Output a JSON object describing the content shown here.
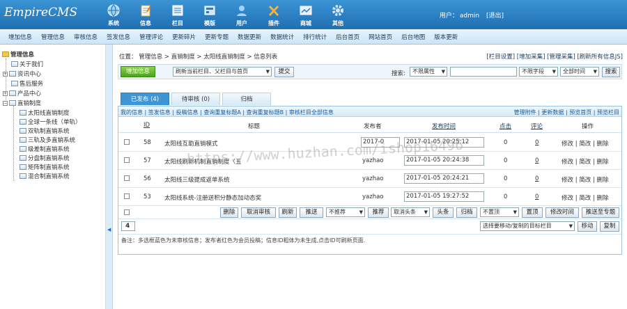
{
  "app": {
    "logo": "EmpireCMS"
  },
  "topnav": [
    {
      "label": "系统",
      "icon": "globe-icon"
    },
    {
      "label": "信息",
      "icon": "notepad-icon"
    },
    {
      "label": "栏目",
      "icon": "folder-icon"
    },
    {
      "label": "模版",
      "icon": "template-icon"
    },
    {
      "label": "用户",
      "icon": "user-icon"
    },
    {
      "label": "插件",
      "icon": "tools-icon"
    },
    {
      "label": "商城",
      "icon": "shop-icon"
    },
    {
      "label": "其他",
      "icon": "gear-icon"
    }
  ],
  "user": {
    "prefix": "用户：",
    "name": "admin",
    "logout": "[退出]"
  },
  "menubar": [
    "增加信息",
    "管理信息",
    "审核信息",
    "签发信息",
    "管理评论",
    "更新碎片",
    "更新专题",
    "数据更新",
    "数据统计",
    "排行统计",
    "后台首页",
    "网站首页",
    "后台地图",
    "版本更新"
  ],
  "sidebar": {
    "root": "管理信息",
    "items": [
      {
        "label": "关于我们",
        "type": "leaf"
      },
      {
        "label": "资讯中心",
        "type": "folder"
      },
      {
        "label": "售后服务",
        "type": "leaf"
      },
      {
        "label": "产品中心",
        "type": "folder"
      },
      {
        "label": "直销制度",
        "type": "folder-open"
      },
      {
        "label": "太阳线直销制度",
        "type": "child"
      },
      {
        "label": "全球一条线（单轨）",
        "type": "child"
      },
      {
        "label": "双轨制直销系统",
        "type": "child"
      },
      {
        "label": "三轨及多直销系统",
        "type": "child"
      },
      {
        "label": "级差制直销系统",
        "type": "child"
      },
      {
        "label": "分盘制直销系统",
        "type": "child"
      },
      {
        "label": "矩阵制直销系统",
        "type": "child"
      },
      {
        "label": "混合制直销系统",
        "type": "child"
      }
    ]
  },
  "breadcrumb": "位置： 管理信息 > 直销制度 > 太阳线直销制度 > 信息列表",
  "toplinks": "[栏目设置] [增加采集] [管理采集] [刷新所有信息JS]",
  "filter": {
    "add_label": "增加信息",
    "refresh_select": "刷新当前栏目、父栏目与首页",
    "submit_label": "提交",
    "search_label": "搜索:",
    "attr_select": "不限属性",
    "search_value": "",
    "field_select": "不限字段",
    "time_select": "全部时间",
    "search_button": "搜索"
  },
  "tabs": [
    "已发布 (4)",
    "待审核 (0)",
    "归档"
  ],
  "links_left": "我的信息 | 签发信息 | 投稿信息 | 查询重复标题A | 查询重复标题B | 审核栏目全部信息",
  "links_right": "管理附件 | 更新数据 | 预览首页 | 预览栏目",
  "columns": {
    "id": "ID",
    "title": "标题",
    "publisher": "发布者",
    "time": "发布时间",
    "clicks": "点击",
    "comments": "评论",
    "ops": "操作"
  },
  "rows": [
    {
      "id": "58",
      "title": "太阳线互助直销模式",
      "publisher": "2017-0",
      "time": "2017-01-05 20:25:12",
      "clicks": "0",
      "comments": "0",
      "ops": "修改 | 简改 | 删除"
    },
    {
      "id": "57",
      "title": "太阳线刷新机制直销制度（五",
      "publisher": "yazhao",
      "time": "2017-01-05 20:24:38",
      "clicks": "0",
      "comments": "0",
      "ops": "修改 | 简改 | 删除"
    },
    {
      "id": "56",
      "title": "太阳线三级提成返单系统",
      "publisher": "yazhao",
      "time": "2017-01-05 20:24:21",
      "clicks": "0",
      "comments": "0",
      "ops": "修改 | 简改 | 删除"
    },
    {
      "id": "53",
      "title": "太阳线系统-注册送积分静态加动态奖",
      "publisher": "yazhao",
      "time": "2017-01-05 19:27:52",
      "clicks": "0",
      "comments": "0",
      "ops": "修改 | 简改 | 删除"
    }
  ],
  "actions": {
    "delete": "删除",
    "unapprove": "取消审核",
    "refresh": "刷新",
    "push": "推送",
    "recommend_select": "不推荐",
    "recommend": "推荐",
    "headline_select": "取消头条",
    "headline": "头条",
    "archive": "归档",
    "top_select": "不置顶",
    "top": "置顶",
    "edit_time": "修改时间",
    "push_topic": "推送至专题"
  },
  "pager": {
    "page": "4",
    "move_select": "选择要移动/复制的目标栏目",
    "move": "移动",
    "copy": "复制"
  },
  "note": "备注：多选框蓝色为未审核信息；发布者红色为会员投稿；信息ID粗体为未生成,点击ID可刷新页面.",
  "watermark": "https://www.huzhan.com/ishop16496",
  "colors": {
    "header": "#2a82c6",
    "tab_active": "#3f95d3",
    "add_button": "#5cb52a"
  }
}
